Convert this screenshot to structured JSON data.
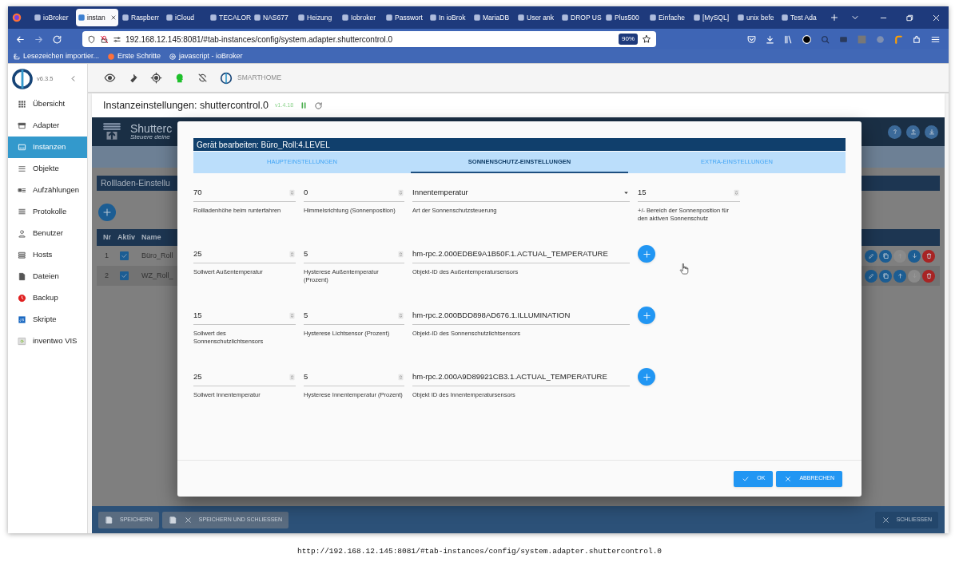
{
  "browser": {
    "tabs": [
      {
        "label": "ioBroker",
        "selected": false
      },
      {
        "label": "instan",
        "selected": true
      },
      {
        "label": "Raspberr",
        "selected": false
      },
      {
        "label": "iCloud",
        "selected": false
      },
      {
        "label": "TECALOR",
        "selected": false
      },
      {
        "label": "NAS677",
        "selected": false
      },
      {
        "label": "Heizung",
        "selected": false
      },
      {
        "label": "Iobroker",
        "selected": false
      },
      {
        "label": "Passwort",
        "selected": false
      },
      {
        "label": "In ioBrok",
        "selected": false
      },
      {
        "label": "MariaDB",
        "selected": false
      },
      {
        "label": "User ank",
        "selected": false
      },
      {
        "label": "DROP US",
        "selected": false
      },
      {
        "label": "Plus500",
        "selected": false
      },
      {
        "label": "Einfache",
        "selected": false
      },
      {
        "label": "[MySQL]",
        "selected": false
      },
      {
        "label": "unix befe",
        "selected": false
      },
      {
        "label": "Test Ada",
        "selected": false
      }
    ],
    "url": "192.168.12.145:8081/#tab-instances/config/system.adapter.shuttercontrol.0",
    "zoom": "90%",
    "bookmarks": [
      "Lesezeichen importier...",
      "Erste Schritte",
      "javascript - ioBroker"
    ]
  },
  "sidebar": {
    "version": "v6.3.5",
    "items": [
      {
        "label": "Übersicht",
        "selected": false
      },
      {
        "label": "Adapter",
        "selected": false
      },
      {
        "label": "Instanzen",
        "selected": true
      },
      {
        "label": "Objekte",
        "selected": false
      },
      {
        "label": "Aufzählungen",
        "selected": false
      },
      {
        "label": "Protokolle",
        "selected": false
      },
      {
        "label": "Benutzer",
        "selected": false
      },
      {
        "label": "Hosts",
        "selected": false
      },
      {
        "label": "Dateien",
        "selected": false
      },
      {
        "label": "Backup",
        "selected": false
      },
      {
        "label": "Skripte",
        "selected": false
      },
      {
        "label": "inventwo VIS",
        "selected": false
      }
    ]
  },
  "toolbar": {
    "brand": "SMARTHOME"
  },
  "instance": {
    "title": "Instanzeinstellungen: shuttercontrol.0",
    "version": "v1.4.18"
  },
  "adapter_page": {
    "title": "Shutterc",
    "subtitle": "Steuere deine",
    "section": "Rollladen-Einstellu",
    "columns": [
      "Nr",
      "Aktiv",
      "Name"
    ],
    "rows": [
      {
        "nr": "1",
        "checked": true,
        "name": "Büro_Roll",
        "actions": [
          {
            "kind": "edit",
            "disabled": false
          },
          {
            "kind": "copy",
            "disabled": false
          },
          {
            "kind": "up",
            "disabled": true
          },
          {
            "kind": "down",
            "disabled": false
          },
          {
            "kind": "delete",
            "disabled": false
          }
        ]
      },
      {
        "nr": "2",
        "checked": true,
        "name": "WZ_Roll_",
        "actions": [
          {
            "kind": "edit",
            "disabled": false
          },
          {
            "kind": "copy",
            "disabled": false
          },
          {
            "kind": "up",
            "disabled": false
          },
          {
            "kind": "down",
            "disabled": true
          },
          {
            "kind": "delete",
            "disabled": false
          }
        ]
      }
    ],
    "buttons": [
      {
        "label": "SPEICHERN",
        "kind": "save",
        "disabled": true
      },
      {
        "label": "SPEICHERN UND SCHLIESSEN",
        "kind": "save_close",
        "disabled": true
      },
      {
        "label": "SCHLIESSEN",
        "kind": "close",
        "disabled": false
      }
    ]
  },
  "dialog": {
    "title": "Gerät bearbeiten: Büro_Roll:4.LEVEL",
    "tabs": [
      {
        "label": "HAUPTEINSTELLUNGEN",
        "selected": false
      },
      {
        "label": "SONNENSCHUTZ-EINSTELLUNGEN",
        "selected": true
      },
      {
        "label": "EXTRA-EINSTELLUNGEN",
        "selected": false
      }
    ],
    "rows": [
      [
        {
          "kind": "number",
          "value": "70",
          "label": "Rollladenhöhe beim runterfahren"
        },
        {
          "kind": "number",
          "value": "0",
          "label": "Himmelsrichtung (Sonnenposition)"
        },
        {
          "kind": "select",
          "value": "Innentemperatur",
          "label": "Art der Sonnenschutzsteuerung"
        },
        {
          "kind": "number",
          "value": "15",
          "label": "+/- Bereich der Sonnenposition für den aktiven Sonnenschutz"
        }
      ],
      [
        {
          "kind": "number",
          "value": "25",
          "label": "Sollwert Außentemperatur"
        },
        {
          "kind": "number",
          "value": "5",
          "label": "Hysterese Außentemperatur (Prozent)"
        },
        {
          "kind": "object",
          "value": "hm-rpc.2.000EDBE9A1B50F.1.ACTUAL_TEMPERATURE",
          "label": "Objekt-ID des Außentemperatursensors"
        }
      ],
      [
        {
          "kind": "number",
          "value": "15",
          "label": "Sollwert des Sonnenschutzlichtsensors"
        },
        {
          "kind": "number",
          "value": "5",
          "label": "Hysterese Lichtsensor (Prozent)"
        },
        {
          "kind": "object",
          "value": "hm-rpc.2.000BDD898AD676.1.ILLUMINATION",
          "label": "Objekt-ID des Sonnenschutzlichtsensors"
        }
      ],
      [
        {
          "kind": "number",
          "value": "25",
          "label": "Sollwert Innentemperatur"
        },
        {
          "kind": "number",
          "value": "5",
          "label": "Hysterese Innentemperatur (Prozent)"
        },
        {
          "kind": "object",
          "value": "hm-rpc.2.000A9D89921CB3.1.ACTUAL_TEMPERATURE",
          "label": "Objekt ID des Innentemperatursensors"
        }
      ]
    ],
    "buttons": [
      {
        "label": "OK",
        "kind": "ok"
      },
      {
        "label": "ABBRECHEN",
        "kind": "cancel"
      }
    ]
  },
  "caption": "http://192.168.12.145:8081/#tab-instances/config/system.adapter.shuttercontrol.0"
}
